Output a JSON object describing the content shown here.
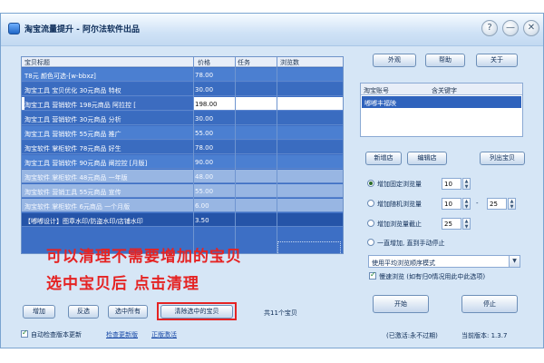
{
  "window": {
    "title": "淘宝流量提升 - 阿尔法软件出品"
  },
  "window_buttons": {
    "help": "?",
    "minimize": "—",
    "close": "✕"
  },
  "grid": {
    "columns": [
      "宝贝标题",
      "价格",
      "任务",
      "浏览数"
    ],
    "rows": [
      {
        "title": "T8元 颜色可选-[w-bbxz]",
        "price": "78.00",
        "style": "row-a"
      },
      {
        "title": "淘宝工具 宝贝优化 30元商品 特权",
        "price": "30.00",
        "style": "row-b"
      },
      {
        "title": "淘宝工具 营销软件 198元商品 阿拉控 [",
        "price": "198.00",
        "style": "row-w"
      },
      {
        "title": "淘宝工具 营销软件 30元商品 分析",
        "price": "30.00",
        "style": "row-b"
      },
      {
        "title": "淘宝工具 营销软件 55元商品 推广",
        "price": "55.00",
        "style": "row-a"
      },
      {
        "title": "淘宝软件 掌柜软件 78元商品 好生",
        "price": "78.00",
        "style": "row-b"
      },
      {
        "title": "淘宝工具 营销软件 90元商品 阐控控 [月版]",
        "price": "90.00",
        "style": "row-a"
      },
      {
        "title": "淘宝软件 掌柜软件 48元商品 一年版",
        "price": "48.00",
        "style": "row-faded"
      },
      {
        "title": "淘宝软件 营销工具 55元商品 宣传",
        "price": "55.00",
        "style": "row-faded"
      },
      {
        "title": "淘宝软件 掌柜软件 6元商品 一个月版",
        "price": "6.00",
        "style": "row-faded"
      },
      {
        "title": "【嘟嘟设计】图章水印/防盗水印/店铺水印",
        "price": "3.50",
        "style": "row-sel"
      }
    ]
  },
  "overlay": {
    "line1": "可以清理不需要增加的宝贝",
    "line2": "选中宝贝后 点击清理"
  },
  "buttons": {
    "add": "增加",
    "invert": "反选",
    "select_all": "选中所有",
    "clear_selected": "清除选中的宝贝",
    "appearance": "外观",
    "help": "帮助",
    "about": "关于",
    "new_shop": "新增店",
    "edit_shop": "编辑店",
    "list_items": "列出宝贝",
    "start": "开始",
    "stop": "停止"
  },
  "item_count": "共11个宝贝",
  "auto_check": {
    "label": "自动检查版本更新",
    "checked": true
  },
  "links": {
    "check_update": "检查更新版",
    "register": "正版激活"
  },
  "accounts": {
    "columns": [
      "淘宝账号",
      "含关键字"
    ],
    "rows": [
      {
        "account": "嘟嘟丰福映",
        "keyword": ""
      }
    ]
  },
  "options": {
    "fixed_views": {
      "label": "增加固定浏览量",
      "value": "10",
      "selected": true
    },
    "random_views": {
      "label": "增加随机浏览量",
      "from": "10",
      "dash": "-",
      "to": "25",
      "selected": false
    },
    "stop_after": {
      "label": "增加浏览量截止",
      "value": "25",
      "selected": false
    },
    "until_manual": {
      "label": "一直增加, 直到手动停止",
      "selected": false
    }
  },
  "mode_select": {
    "value": "使用平均浏览顺序模式"
  },
  "slow_browse": {
    "label": "慢速浏览 (如有归0情况用此中此选项)",
    "checked": true
  },
  "status": {
    "activation": "(已激活:永不过期)",
    "version": "当前版本: 1.3.7"
  }
}
